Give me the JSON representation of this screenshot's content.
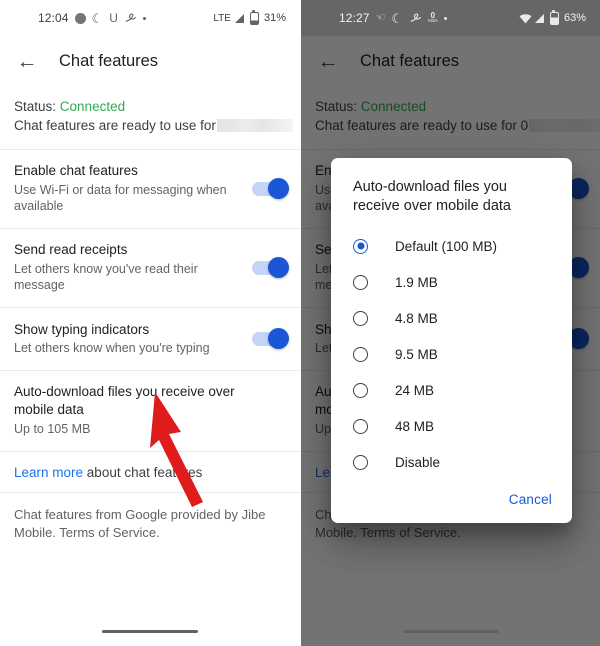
{
  "left_phone": {
    "status_bar": {
      "time": "12:04",
      "icons_left": [
        "avatar-circle-icon",
        "crescent-moon-icon",
        "u-letter-icon",
        "swirl-icon",
        "small-dot-icon"
      ],
      "network": "LTE",
      "signal": "signal-bars-icon",
      "battery_icon": "battery-icon",
      "battery": "31%"
    },
    "appbar": {
      "back_icon": "back-arrow-icon",
      "title": "Chat features"
    },
    "status_block": {
      "label": "Status:",
      "value": "Connected",
      "description": "Chat features are ready to use for",
      "redacted": true
    },
    "settings": [
      {
        "title": "Enable chat features",
        "subtitle": "Use Wi-Fi or data for messaging when available",
        "toggle": true
      },
      {
        "title": "Send read receipts",
        "subtitle": "Let others know you've read their message",
        "toggle": true
      },
      {
        "title": "Show typing indicators",
        "subtitle": "Let others know when you're typing",
        "toggle": true
      },
      {
        "title": "Auto-download files you receive over mobile data",
        "subtitle": "Up to 105 MB",
        "toggle": null
      }
    ],
    "learn_more": {
      "link_text": "Learn more",
      "rest_text": " about chat features"
    },
    "footnote": "Chat features from Google provided by Jibe Mobile. Terms of Service.",
    "annotation": {
      "type": "arrow",
      "color": "#e01b1b",
      "points_at": "Auto-download files you receive over mobile data"
    }
  },
  "right_phone": {
    "status_bar": {
      "time": "12:27",
      "icons_left": [
        "hand-icon",
        "crescent-moon-icon",
        "swirl-icon",
        "data-rate-icon",
        "small-dot-icon"
      ],
      "data_rate_value": "0",
      "data_rate_unit": "KB/s",
      "wifi_icon": "wifi-icon",
      "signal": "signal-bars-icon",
      "battery_icon": "battery-icon",
      "battery": "63%"
    },
    "appbar": {
      "back_icon": "back-arrow-icon",
      "title": "Chat features"
    },
    "status_block": {
      "label": "Status:",
      "value": "Connected",
      "description": "Chat features are ready to use for 0",
      "redacted": true
    },
    "settings": [
      {
        "title": "Enable chat features",
        "subtitle": "Use Wi-Fi or data for messaging when available",
        "toggle": true
      },
      {
        "title": "Send read receipts",
        "subtitle": "Let others know you've read their message",
        "toggle": true
      },
      {
        "title": "Show typing indicators",
        "subtitle": "Let others know when you're typing",
        "toggle": true
      },
      {
        "title": "Auto-download files you receive over mobile data",
        "subtitle": "Up to 105 MB",
        "toggle": null
      }
    ],
    "learn_more": {
      "link_text": "Learn more",
      "rest_text": " about chat features"
    },
    "footnote": "Chat features from Google provided by Jibe Mobile. Terms of Service.",
    "dialog": {
      "title": "Auto-download files you receive over mobile data",
      "options": [
        {
          "label": "Default (100 MB)",
          "selected": true
        },
        {
          "label": "1.9 MB",
          "selected": false
        },
        {
          "label": "4.8 MB",
          "selected": false
        },
        {
          "label": "9.5 MB",
          "selected": false
        },
        {
          "label": "24 MB",
          "selected": false
        },
        {
          "label": "48 MB",
          "selected": false
        },
        {
          "label": "Disable",
          "selected": false
        }
      ],
      "cancel_label": "Cancel"
    }
  },
  "colors": {
    "accent_blue": "#1a56d6",
    "link_blue": "#1a73e8",
    "connected_green": "#34a853",
    "annotation_red": "#e01b1b",
    "scrim": "rgba(0,0,0,0.55)"
  }
}
